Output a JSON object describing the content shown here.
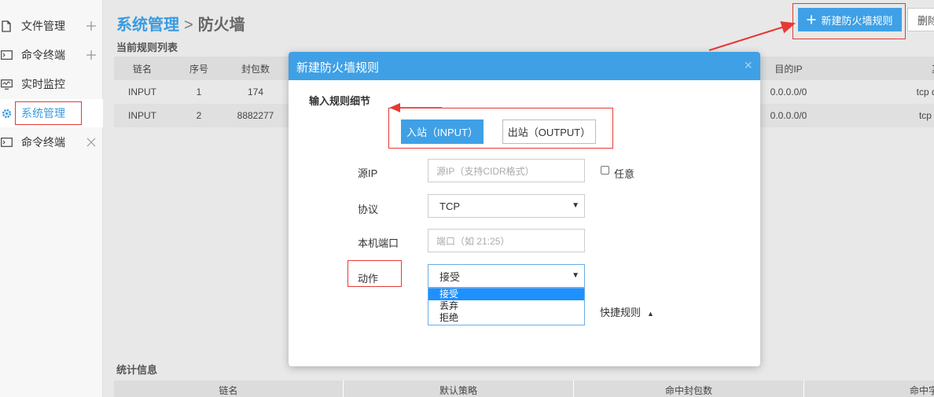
{
  "sidebar": {
    "items": [
      {
        "label": "文件管理",
        "icon": "file-icon",
        "action": "+"
      },
      {
        "label": "命令终端",
        "icon": "terminal-icon",
        "action": "+"
      },
      {
        "label": "实时监控",
        "icon": "monitor-icon",
        "action": ""
      },
      {
        "label": "系统管理",
        "icon": "gear-icon",
        "action": ""
      },
      {
        "label": "命令终端",
        "icon": "terminal-icon",
        "action": "×"
      }
    ]
  },
  "header": {
    "breadcrumb": "系统管理",
    "separator": ">",
    "current": "防火墙",
    "new_rule_button": "新建防火墙规则",
    "delete_button": "删除"
  },
  "rules": {
    "title": "当前规则列表",
    "columns": [
      "链名",
      "序号",
      "封包数",
      "目的IP",
      "其"
    ],
    "rows": [
      {
        "chain": "INPUT",
        "num": "1",
        "packets": "174",
        "dest_ip": "0.0.0.0/0",
        "extra": "tcp dpt:"
      },
      {
        "chain": "INPUT",
        "num": "2",
        "packets": "8882277",
        "dest_ip": "0.0.0.0/0",
        "extra": "tcp dpt"
      }
    ]
  },
  "stats": {
    "title": "统计信息",
    "columns": [
      "链名",
      "默认策略",
      "命中封包数",
      "命中字节"
    ]
  },
  "modal": {
    "title": "新建防火墙规则",
    "close": "×",
    "section_title": "输入规则细节",
    "direction_in": "入站（INPUT）",
    "direction_out": "出站（OUTPUT）",
    "source_ip_label": "源IP",
    "source_ip_placeholder": "源IP（支持CIDR格式）",
    "any_label": "任意",
    "protocol_label": "协议",
    "protocol_value": "TCP",
    "port_label": "本机端口",
    "port_placeholder": "端口（如 21:25）",
    "action_label": "动作",
    "action_value": "接受",
    "action_options": [
      "接受",
      "丢弃",
      "拒绝"
    ],
    "quick_rules": "快捷规则"
  },
  "colors": {
    "accent": "#3fa0e6",
    "highlight": "#e53935"
  }
}
